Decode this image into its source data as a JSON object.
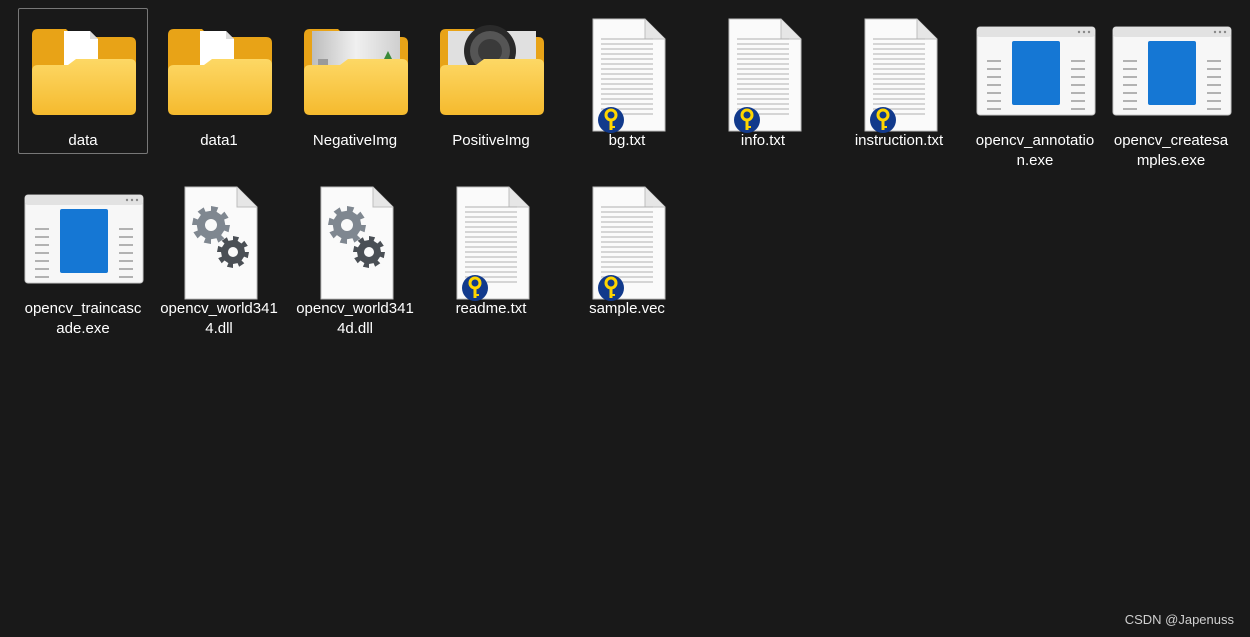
{
  "items": [
    {
      "name": "data",
      "type": "folder",
      "thumb": "doc",
      "selected": true
    },
    {
      "name": "data1",
      "type": "folder",
      "thumb": "doc"
    },
    {
      "name": "NegativeImg",
      "type": "folder",
      "thumb": "photo"
    },
    {
      "name": "PositiveImg",
      "type": "folder",
      "thumb": "dark-photo"
    },
    {
      "name": "bg.txt",
      "type": "txt",
      "icon": "key-badge-icon"
    },
    {
      "name": "info.txt",
      "type": "txt",
      "icon": "key-badge-icon"
    },
    {
      "name": "instruction.txt",
      "type": "txt",
      "icon": "key-badge-icon"
    },
    {
      "name": "opencv_annotation.exe",
      "type": "exe"
    },
    {
      "name": "opencv_createsamples.exe",
      "type": "exe"
    },
    {
      "name": "opencv_traincascade.exe",
      "type": "exe"
    },
    {
      "name": "opencv_world3414.dll",
      "type": "dll"
    },
    {
      "name": "opencv_world3414d.dll",
      "type": "dll"
    },
    {
      "name": "readme.txt",
      "type": "txt",
      "icon": "key-badge-icon"
    },
    {
      "name": "sample.vec",
      "type": "txt",
      "icon": "key-badge-icon"
    }
  ],
  "watermark": "CSDN @Japenuss",
  "colors": {
    "background": "#191919",
    "folder_front": "#F9C646",
    "folder_back": "#E8A317",
    "exe_blue": "#1577D4"
  }
}
